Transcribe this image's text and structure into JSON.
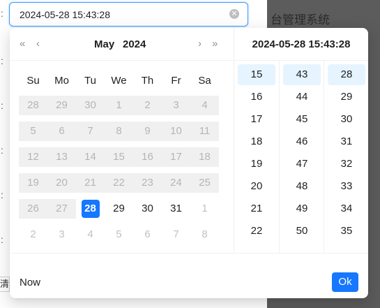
{
  "background": {
    "title_fragment": "台管理系统",
    "bottom_button_fragment": "清"
  },
  "input": {
    "value": "2024-05-28 15:43:28",
    "clear_icon": "close-circle-icon"
  },
  "picker": {
    "nav": {
      "super_prev": "«",
      "prev": "‹",
      "next": "›",
      "super_next": "»"
    },
    "month": "May",
    "year": "2024",
    "weekdays": [
      "Su",
      "Mo",
      "Tu",
      "We",
      "Th",
      "Fr",
      "Sa"
    ],
    "weeks": [
      [
        {
          "d": "28",
          "s": "dis"
        },
        {
          "d": "29",
          "s": "dis"
        },
        {
          "d": "30",
          "s": "dis"
        },
        {
          "d": "1",
          "s": "dis"
        },
        {
          "d": "2",
          "s": "dis"
        },
        {
          "d": "3",
          "s": "dis"
        },
        {
          "d": "4",
          "s": "dis"
        }
      ],
      [
        {
          "d": "5",
          "s": "dis"
        },
        {
          "d": "6",
          "s": "dis"
        },
        {
          "d": "7",
          "s": "dis"
        },
        {
          "d": "8",
          "s": "dis"
        },
        {
          "d": "9",
          "s": "dis"
        },
        {
          "d": "10",
          "s": "dis"
        },
        {
          "d": "11",
          "s": "dis"
        }
      ],
      [
        {
          "d": "12",
          "s": "dis"
        },
        {
          "d": "13",
          "s": "dis"
        },
        {
          "d": "14",
          "s": "dis"
        },
        {
          "d": "15",
          "s": "dis"
        },
        {
          "d": "16",
          "s": "dis"
        },
        {
          "d": "17",
          "s": "dis"
        },
        {
          "d": "18",
          "s": "dis"
        }
      ],
      [
        {
          "d": "19",
          "s": "dis"
        },
        {
          "d": "20",
          "s": "dis"
        },
        {
          "d": "21",
          "s": "dis"
        },
        {
          "d": "22",
          "s": "dis"
        },
        {
          "d": "23",
          "s": "dis"
        },
        {
          "d": "24",
          "s": "dis"
        },
        {
          "d": "25",
          "s": "dis"
        }
      ],
      [
        {
          "d": "26",
          "s": "dis"
        },
        {
          "d": "27",
          "s": "dis"
        },
        {
          "d": "28",
          "s": "sel"
        },
        {
          "d": "29",
          "s": "in"
        },
        {
          "d": "30",
          "s": "in"
        },
        {
          "d": "31",
          "s": "in"
        },
        {
          "d": "1",
          "s": "out"
        }
      ],
      [
        {
          "d": "2",
          "s": "out"
        },
        {
          "d": "3",
          "s": "out"
        },
        {
          "d": "4",
          "s": "out"
        },
        {
          "d": "5",
          "s": "out"
        },
        {
          "d": "6",
          "s": "out"
        },
        {
          "d": "7",
          "s": "out"
        },
        {
          "d": "8",
          "s": "out"
        }
      ]
    ],
    "time_header": "2024-05-28 15:43:28",
    "hours": [
      "15",
      "16",
      "17",
      "18",
      "19",
      "20",
      "21",
      "22"
    ],
    "minutes": [
      "43",
      "44",
      "45",
      "46",
      "47",
      "48",
      "49",
      "50"
    ],
    "seconds": [
      "28",
      "29",
      "30",
      "31",
      "32",
      "33",
      "34",
      "35"
    ],
    "selected_hour": "15",
    "selected_minute": "43",
    "selected_second": "28",
    "now_label": "Now",
    "ok_label": "Ok"
  },
  "colors": {
    "accent": "#1677ff",
    "selected_time_bg": "#e6f4ff",
    "disabled_bg": "#f0f0f0"
  }
}
